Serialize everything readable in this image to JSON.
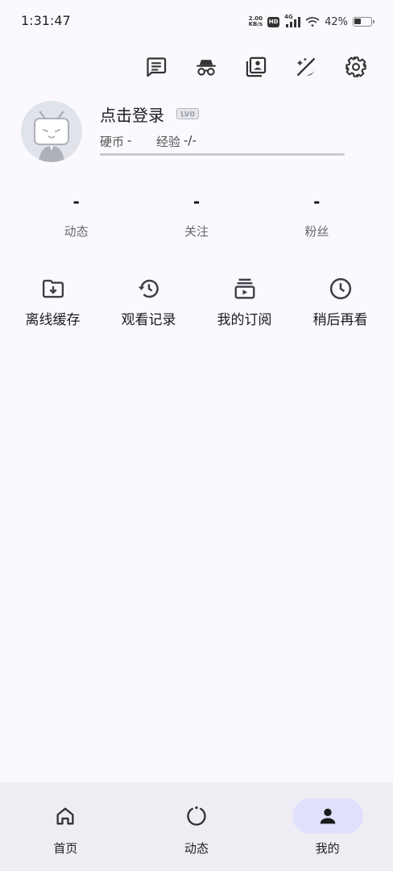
{
  "status_bar": {
    "time": "1:31:47",
    "net_speed_value": "2.00",
    "net_speed_unit": "KB/s",
    "hd_label": "HD",
    "network_type": "4G",
    "battery_percent": "42%",
    "battery_level": 0.42
  },
  "toolbar": {
    "icons": [
      "message-icon",
      "incognito-icon",
      "collection-icon",
      "theme-toggle-icon",
      "settings-icon"
    ]
  },
  "profile": {
    "login_text": "点击登录",
    "level_badge": "LV0",
    "coins_label": "硬币",
    "coins_value": "-",
    "exp_label": "经验",
    "exp_value": "-/-",
    "exp_progress": 0
  },
  "counts": [
    {
      "value": "-",
      "label": "动态"
    },
    {
      "value": "-",
      "label": "关注"
    },
    {
      "value": "-",
      "label": "粉丝"
    }
  ],
  "quick_actions": [
    {
      "label": "离线缓存",
      "icon": "download-folder-icon"
    },
    {
      "label": "观看记录",
      "icon": "history-icon"
    },
    {
      "label": "我的订阅",
      "icon": "subscriptions-icon"
    },
    {
      "label": "稍后再看",
      "icon": "clock-icon"
    }
  ],
  "bottom_nav": [
    {
      "label": "首页",
      "icon": "home-icon",
      "active": false
    },
    {
      "label": "动态",
      "icon": "dynamics-icon",
      "active": false
    },
    {
      "label": "我的",
      "icon": "person-icon",
      "active": true
    }
  ],
  "colors": {
    "background": "#fbf9fe",
    "nav_background": "#efedf4",
    "active_pill": "#dfe0fb"
  }
}
